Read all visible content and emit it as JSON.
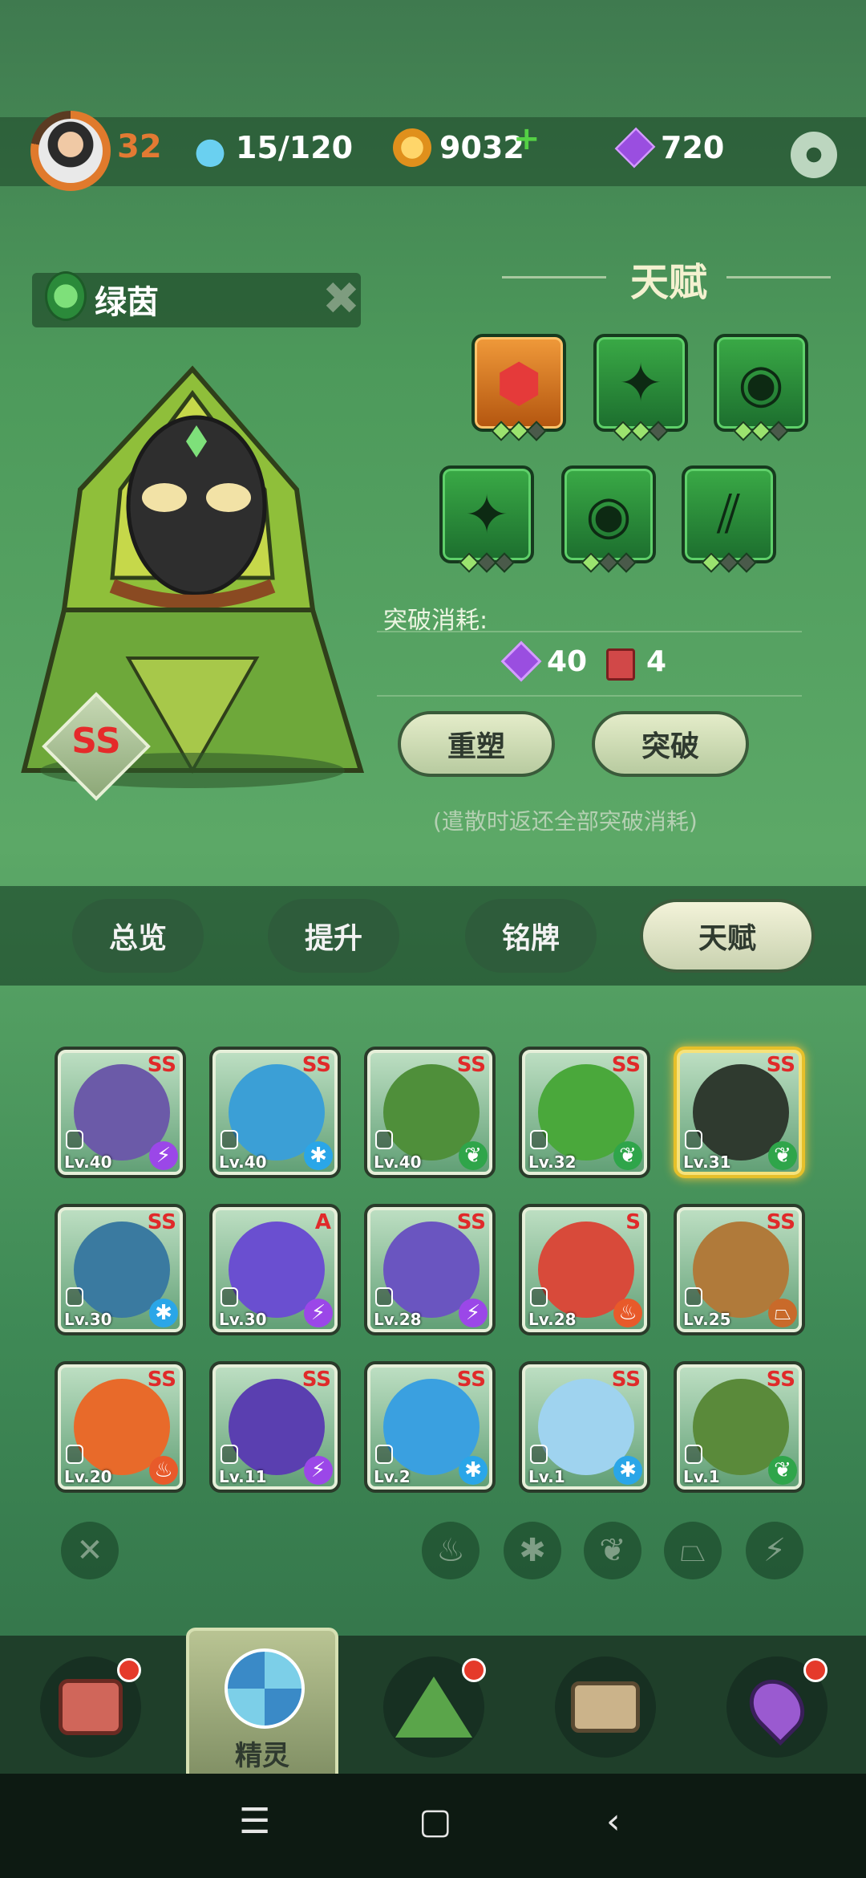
{
  "status": {
    "level": "32",
    "energy": "15/120",
    "coins": "9032",
    "coin_plus": "+",
    "gems": "720"
  },
  "pet": {
    "name": "绿茵",
    "grade": "SS",
    "element": "leaf"
  },
  "talent": {
    "title": "天赋",
    "slots": [
      {
        "glyph": "⬢",
        "color": "orange",
        "dots": [
          1,
          1,
          0
        ]
      },
      {
        "glyph": "✦",
        "color": "green",
        "dots": [
          1,
          1,
          0
        ]
      },
      {
        "glyph": "◉",
        "color": "green",
        "dots": [
          1,
          1,
          0
        ]
      },
      {
        "glyph": "✦",
        "color": "green",
        "dots": [
          1,
          0,
          0
        ]
      },
      {
        "glyph": "◉",
        "color": "green",
        "dots": [
          1,
          0,
          0
        ]
      },
      {
        "glyph": "⫽",
        "color": "green",
        "dots": [
          1,
          0,
          0
        ]
      }
    ],
    "cost_label": "突破消耗:",
    "cost_gems": "40",
    "cost_books": "4",
    "reset_button": "重塑",
    "breakthrough_button": "突破",
    "note": "(遣散时返还全部突破消耗)"
  },
  "tabs": [
    "总览",
    "提升",
    "铭牌",
    "天赋"
  ],
  "active_tab": 3,
  "pets": [
    {
      "grade": "SS",
      "level": "Lv.40",
      "element": "lightning",
      "color": "#6b5aa8"
    },
    {
      "grade": "SS",
      "level": "Lv.40",
      "element": "ice",
      "color": "#3b9fd6"
    },
    {
      "grade": "SS",
      "level": "Lv.40",
      "element": "leaf",
      "color": "#4f8f3a"
    },
    {
      "grade": "SS",
      "level": "Lv.32",
      "element": "leaf",
      "color": "#4aa83b"
    },
    {
      "grade": "SS",
      "level": "Lv.31",
      "element": "leaf",
      "color": "#2f3a2f"
    },
    {
      "grade": "SS",
      "level": "Lv.30",
      "element": "ice",
      "color": "#3a7aa0"
    },
    {
      "grade": "A",
      "level": "Lv.30",
      "element": "lightning",
      "color": "#6a4fd0"
    },
    {
      "grade": "SS",
      "level": "Lv.28",
      "element": "lightning",
      "color": "#6a55c0"
    },
    {
      "grade": "S",
      "level": "Lv.28",
      "element": "fire",
      "color": "#d84a3a"
    },
    {
      "grade": "SS",
      "level": "Lv.25",
      "element": "earth",
      "color": "#b07a3a"
    },
    {
      "grade": "SS",
      "level": "Lv.20",
      "element": "fire",
      "color": "#e86a2a"
    },
    {
      "grade": "SS",
      "level": "Lv.11",
      "element": "lightning",
      "color": "#5a3fb0"
    },
    {
      "grade": "SS",
      "level": "Lv.2",
      "element": "ice",
      "color": "#3aa0e0"
    },
    {
      "grade": "SS",
      "level": "Lv.1",
      "element": "ice",
      "color": "#9fd3ef"
    },
    {
      "grade": "SS",
      "level": "Lv.1",
      "element": "leaf",
      "color": "#5a8a3a"
    }
  ],
  "selected_pet": 4,
  "filters": [
    "close-icon",
    "fire-icon",
    "ice-icon",
    "leaf-icon",
    "earth-icon",
    "lightning-icon"
  ],
  "nav": {
    "active_label": "精灵"
  },
  "icons": {
    "lightning": "⚡",
    "ice": "✱",
    "leaf": "❦",
    "fire": "♨",
    "earth": "⏢"
  }
}
